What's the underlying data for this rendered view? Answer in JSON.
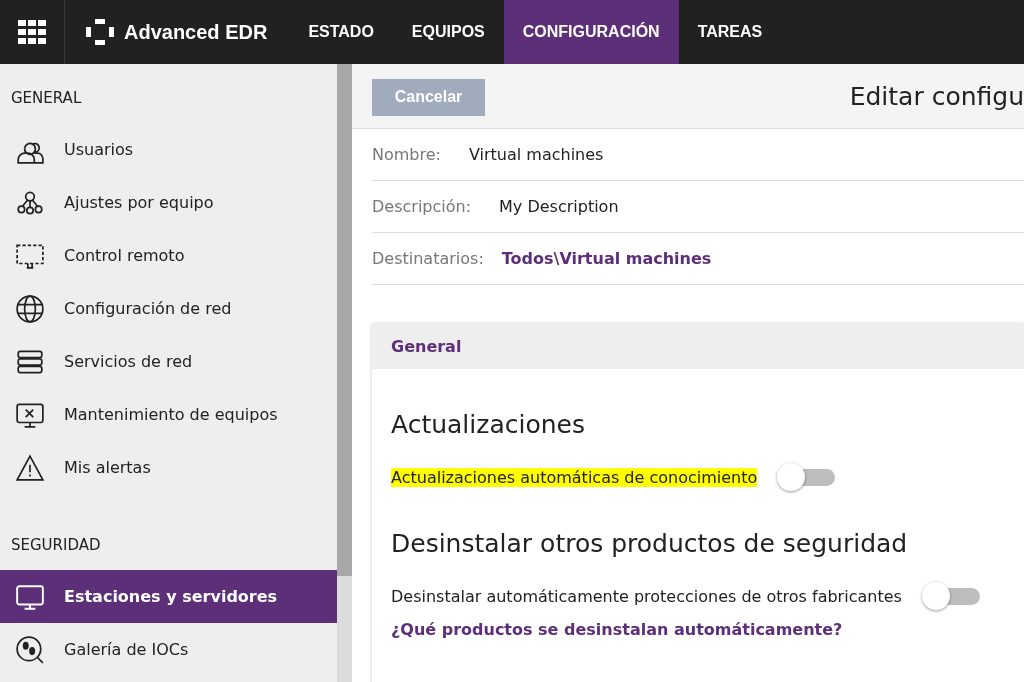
{
  "app": {
    "name": "Advanced EDR"
  },
  "nav_tabs": [
    {
      "label": "ESTADO",
      "selected": false
    },
    {
      "label": "EQUIPOS",
      "selected": false
    },
    {
      "label": "CONFIGURACIÓN",
      "selected": true
    },
    {
      "label": "TAREAS",
      "selected": false
    }
  ],
  "sidebar": {
    "sections": [
      {
        "title": "GENERAL",
        "items": [
          {
            "label": "Usuarios",
            "kind": "users",
            "selected": false
          },
          {
            "label": "Ajustes por equipo",
            "kind": "nodes",
            "selected": false
          },
          {
            "label": "Control remoto",
            "kind": "remote",
            "selected": false
          },
          {
            "label": "Configuración de red",
            "kind": "globe",
            "selected": false
          },
          {
            "label": "Servicios de red",
            "kind": "servers",
            "selected": false
          },
          {
            "label": "Mantenimiento de equipos",
            "kind": "monitorx",
            "selected": false
          },
          {
            "label": "Mis alertas",
            "kind": "warning",
            "selected": false
          }
        ]
      },
      {
        "title": "SEGURIDAD",
        "items": [
          {
            "label": "Estaciones y servidores",
            "kind": "monitor",
            "selected": true
          },
          {
            "label": "Galería de IOCs",
            "kind": "footprints",
            "selected": false
          }
        ]
      }
    ]
  },
  "toolbar": {
    "cancel_button": "Cancelar",
    "title": "Editar configu"
  },
  "fields": [
    {
      "label": "Nombre:",
      "value": "Virtual machines",
      "kind": "text"
    },
    {
      "label": "Descripción:",
      "value": "My Description",
      "kind": "text"
    },
    {
      "label": "Destinatarios:",
      "value": "Todos\\Virtual machines",
      "kind": "link"
    }
  ],
  "panel": {
    "title": "General",
    "sections": [
      {
        "heading": "Actualizaciones",
        "settings": [
          {
            "label": "Actualizaciones automáticas de conocimiento",
            "on": false,
            "highlighted": true
          }
        ]
      },
      {
        "heading": "Desinstalar otros productos de seguridad",
        "settings": [
          {
            "label": "Desinstalar automáticamente protecciones de otros fabricantes",
            "on": false,
            "highlighted": false
          }
        ],
        "link": "¿Qué productos se desinstalan automáticamente?"
      }
    ]
  }
}
